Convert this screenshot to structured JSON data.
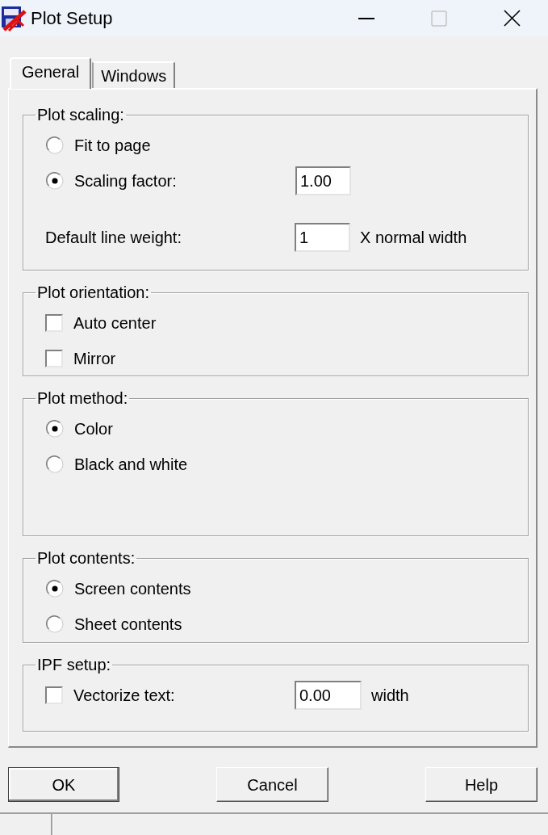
{
  "window": {
    "title": "Plot Setup",
    "maximize_disabled": true
  },
  "tabs": [
    {
      "label": "General",
      "selected": true
    },
    {
      "label": "Windows",
      "selected": false
    }
  ],
  "groups": [
    {
      "title": "Plot scaling:",
      "rows": [
        {
          "kind": "radio",
          "label": "Fit to page",
          "selected": false
        },
        {
          "kind": "radio",
          "label": "Scaling factor:",
          "selected": true,
          "value": "1.00"
        },
        {
          "kind": "label",
          "label": "Default line weight:",
          "value": "1",
          "suffix": "X normal width"
        }
      ]
    },
    {
      "title": "Plot orientation:",
      "rows": [
        {
          "kind": "checkbox",
          "label": "Auto center",
          "checked": false
        },
        {
          "kind": "checkbox",
          "label": "Mirror",
          "checked": false
        }
      ]
    },
    {
      "title": "Plot method:",
      "rows": [
        {
          "kind": "radio",
          "label": "Color",
          "selected": true
        },
        {
          "kind": "radio",
          "label": "Black and white",
          "selected": false
        }
      ]
    },
    {
      "title": "Plot contents:",
      "rows": [
        {
          "kind": "radio",
          "label": "Screen contents",
          "selected": true
        },
        {
          "kind": "radio",
          "label": "Sheet contents",
          "selected": false
        }
      ]
    },
    {
      "title": "IPF setup:",
      "rows": [
        {
          "kind": "checkbox",
          "label": "Vectorize text:",
          "checked": false,
          "value": "0.00",
          "suffix": "width"
        }
      ]
    }
  ],
  "buttons": [
    {
      "label": "OK",
      "default": true
    },
    {
      "label": "Cancel",
      "default": false
    },
    {
      "label": "Help",
      "default": false
    }
  ]
}
